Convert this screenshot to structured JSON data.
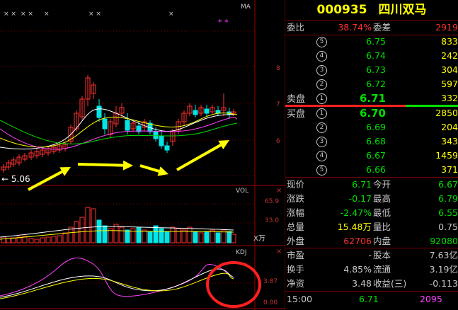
{
  "chart": {
    "ma_label": "MA",
    "star_marks": [
      "× ×",
      "× ×",
      "×",
      "× ×",
      "×"
    ],
    "magenta_stars": "* *",
    "price_ticks": [
      "8",
      "7",
      "6"
    ],
    "low_label": "← 5.06",
    "vol_label": "VOL",
    "vol_ticks": [
      "65.9",
      "33.0"
    ],
    "vol_unit": "X万",
    "kdj_label": "KDJ",
    "kdj_ticks": [
      "3.87",
      "0.00"
    ],
    "accent_yellow": "#ffff00",
    "up_red": "#ff3030",
    "down_cyan": "#00e5e5",
    "circle_red": "#ff2020"
  },
  "quote": {
    "code": "000935",
    "name": "四川双马",
    "weibi_label": "委比",
    "weibi_value": "38.74%",
    "weicha_label": "委差",
    "weicha_value": "2919",
    "sell_label": "卖盘",
    "buy_label": "买盘",
    "asks": [
      {
        "lvl": "5",
        "price": "6.75",
        "vol": "833"
      },
      {
        "lvl": "4",
        "price": "6.74",
        "vol": "242"
      },
      {
        "lvl": "3",
        "price": "6.73",
        "vol": "304"
      },
      {
        "lvl": "2",
        "price": "6.72",
        "vol": "597"
      },
      {
        "lvl": "1",
        "price": "6.71",
        "vol": "332"
      }
    ],
    "bids": [
      {
        "lvl": "1",
        "price": "6.70",
        "vol": "2850"
      },
      {
        "lvl": "2",
        "price": "6.69",
        "vol": "204"
      },
      {
        "lvl": "3",
        "price": "6.68",
        "vol": "343"
      },
      {
        "lvl": "4",
        "price": "6.67",
        "vol": "1459"
      },
      {
        "lvl": "5",
        "price": "6.66",
        "vol": "371"
      }
    ],
    "stats": [
      {
        "l1": "现价",
        "v1": "6.71",
        "c1": "#00e000",
        "l2": "今开",
        "v2": "6.67",
        "c2": "#00e000"
      },
      {
        "l1": "涨跌",
        "v1": "-0.17",
        "c1": "#00e000",
        "l2": "最高",
        "v2": "6.79",
        "c2": "#00e000"
      },
      {
        "l1": "涨幅",
        "v1": "-2.47%",
        "c1": "#00e000",
        "l2": "最低",
        "v2": "6.55",
        "c2": "#00e000"
      },
      {
        "l1": "总量",
        "v1": "15.48万",
        "c1": "#ffff00",
        "l2": "量比",
        "v2": "0.75",
        "c2": "#c8c8c8"
      },
      {
        "l1": "外盘",
        "v1": "62706",
        "c1": "#ff3030",
        "l2": "内盘",
        "v2": "92080",
        "c2": "#00e000"
      }
    ],
    "fund": [
      {
        "l1": "市盈",
        "v1": "-",
        "l2": "股本",
        "v2": "7.63亿"
      },
      {
        "l1": "换手",
        "v1": "4.85%",
        "l2": "流通",
        "v2": "3.19亿"
      },
      {
        "l1": "净资",
        "v1": "3.48",
        "l2": "收益(三)",
        "v2": "-0.113"
      }
    ],
    "last_time": "15:00",
    "last_price": "6.71",
    "last_vol": "2095"
  }
}
